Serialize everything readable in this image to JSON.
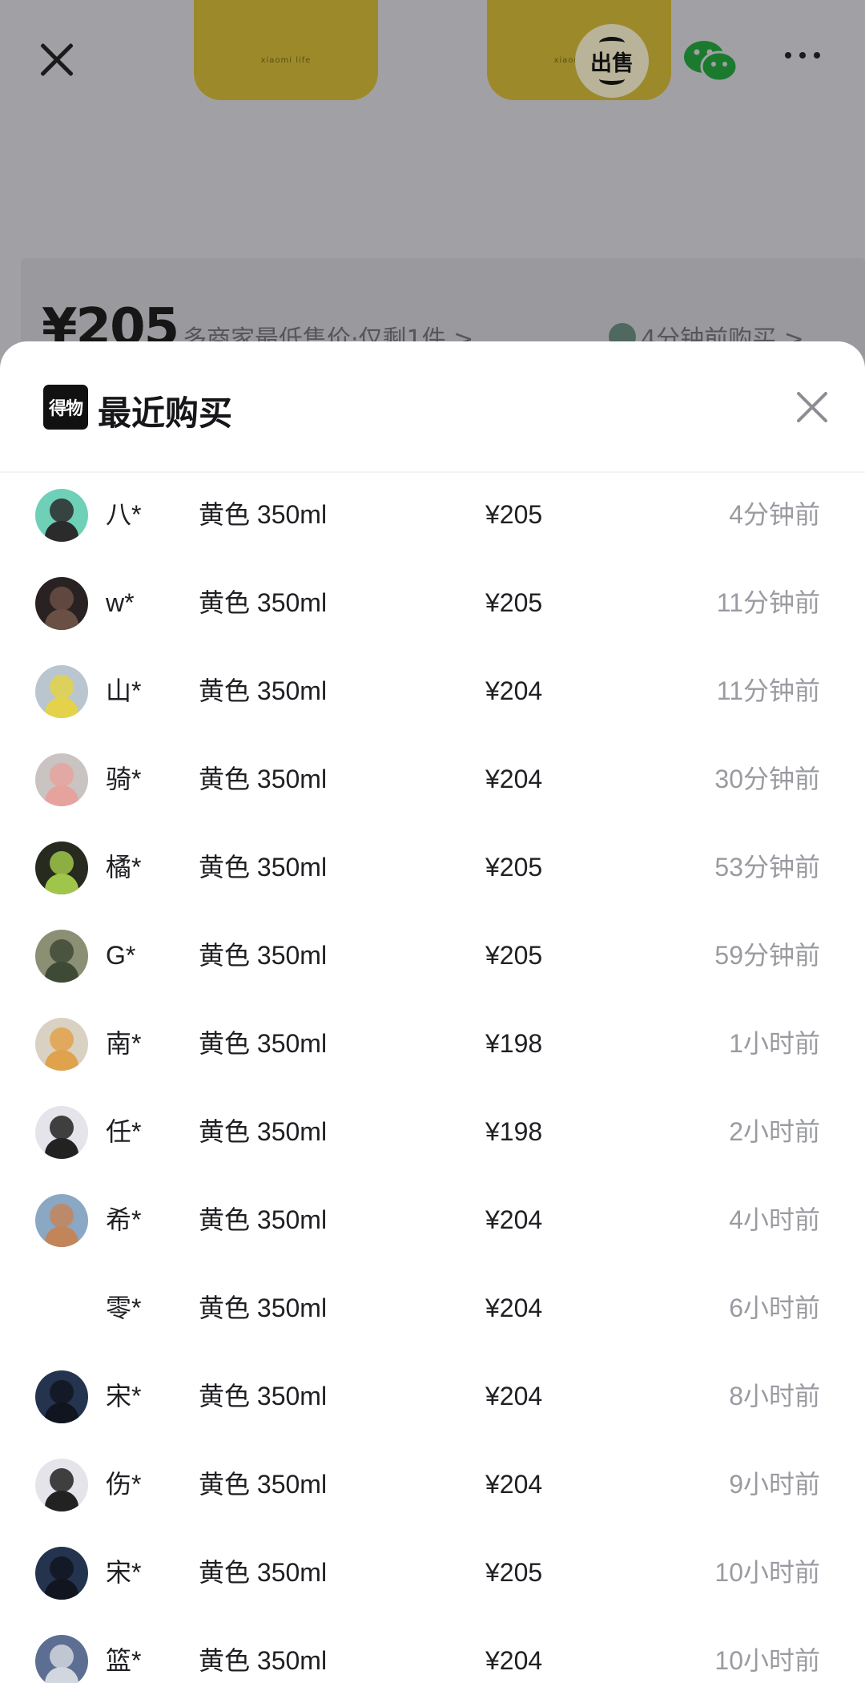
{
  "background": {
    "cup_brand": "xiaomi life",
    "sell_button_label": "出售",
    "price": "¥205",
    "price_note": "多商家最低售价·仅剩1件 >",
    "recent_note": "4分钟前购买 >"
  },
  "sheet": {
    "logo_text": "得物",
    "title": "最近购买",
    "purchases": [
      {
        "name": "八*",
        "spec": "黄色 350ml",
        "price": "¥205",
        "time": "4分钟前",
        "avatar_bg": "#6fd0b8",
        "avatar_fg": "#2b2b2b"
      },
      {
        "name": "w*",
        "spec": "黄色 350ml",
        "price": "¥205",
        "time": "11分钟前",
        "avatar_bg": "#2a2222",
        "avatar_fg": "#6a4f45"
      },
      {
        "name": "山*",
        "spec": "黄色 350ml",
        "price": "¥204",
        "time": "11分钟前",
        "avatar_bg": "#b9c6cf",
        "avatar_fg": "#e3d24a"
      },
      {
        "name": "骑*",
        "spec": "黄色 350ml",
        "price": "¥204",
        "time": "30分钟前",
        "avatar_bg": "#c9c3c2",
        "avatar_fg": "#e6a39d"
      },
      {
        "name": "橘*",
        "spec": "黄色 350ml",
        "price": "¥205",
        "time": "53分钟前",
        "avatar_bg": "#262a1f",
        "avatar_fg": "#9fc64a"
      },
      {
        "name": "G*",
        "spec": "黄色 350ml",
        "price": "¥205",
        "time": "59分钟前",
        "avatar_bg": "#8b8f74",
        "avatar_fg": "#3f4a36"
      },
      {
        "name": "南*",
        "spec": "黄色 350ml",
        "price": "¥198",
        "time": "1小时前",
        "avatar_bg": "#d9d2c3",
        "avatar_fg": "#e0a24c"
      },
      {
        "name": "任*",
        "spec": "黄色 350ml",
        "price": "¥198",
        "time": "2小时前",
        "avatar_bg": "#e4e4ea",
        "avatar_fg": "#222222"
      },
      {
        "name": "希*",
        "spec": "黄色 350ml",
        "price": "¥204",
        "time": "4小时前",
        "avatar_bg": "#8aa7c4",
        "avatar_fg": "#c2855a"
      },
      {
        "name": "零*",
        "spec": "黄色 350ml",
        "price": "¥204",
        "time": "6小时前",
        "avatar_bg": "#ffffff",
        "avatar_fg": "#ffffff"
      },
      {
        "name": "宋*",
        "spec": "黄色 350ml",
        "price": "¥204",
        "time": "8小时前",
        "avatar_bg": "#24344f",
        "avatar_fg": "#10151f"
      },
      {
        "name": "伤*",
        "spec": "黄色 350ml",
        "price": "¥204",
        "time": "9小时前",
        "avatar_bg": "#e4e4ea",
        "avatar_fg": "#222222"
      },
      {
        "name": "宋*",
        "spec": "黄色 350ml",
        "price": "¥205",
        "time": "10小时前",
        "avatar_bg": "#24344f",
        "avatar_fg": "#10151f"
      },
      {
        "name": "篮*",
        "spec": "黄色 350ml",
        "price": "¥204",
        "time": "10小时前",
        "avatar_bg": "#5c6f92",
        "avatar_fg": "#d2d6de"
      }
    ]
  }
}
